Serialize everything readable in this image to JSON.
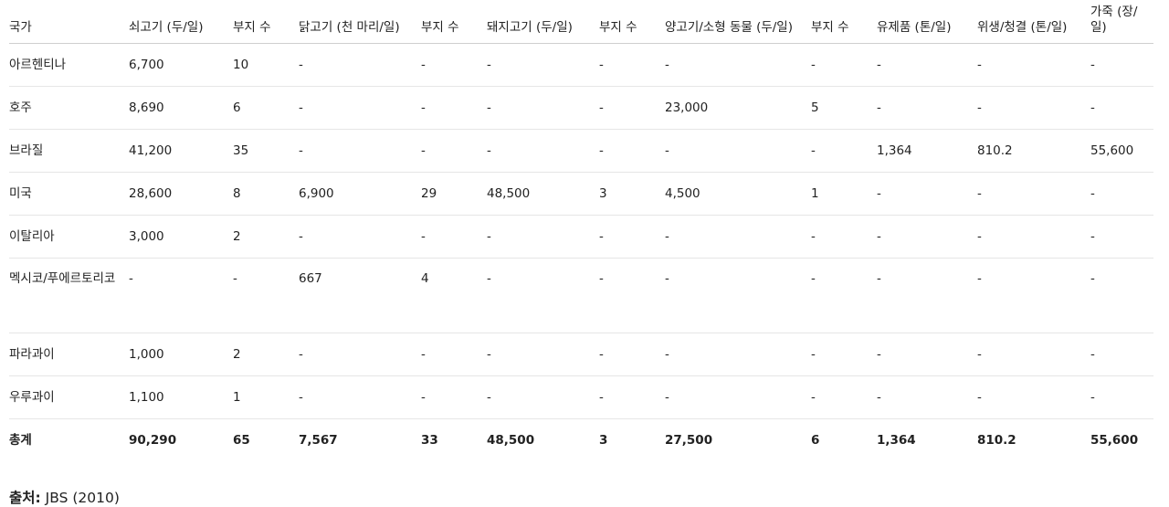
{
  "headers": [
    "국가",
    "쇠고기 (두/일)",
    "부지 수",
    "닭고기 (천 마리/일)",
    "부지 수",
    "돼지고기 (두/일)",
    "부지 수",
    "양고기/소형 동물 (두/일)",
    "부지 수",
    "유제품 (톤/일)",
    "위생/청결 (톤/일)",
    "가죽 (장/일)"
  ],
  "rows": [
    [
      "아르헨티나",
      "6,700",
      "10",
      "-",
      "-",
      "-",
      "-",
      "-",
      "-",
      "-",
      "-",
      "-"
    ],
    [
      "호주",
      "8,690",
      "6",
      "-",
      "-",
      "-",
      "-",
      "23,000",
      "5",
      "-",
      "-",
      "-"
    ],
    [
      "브라질",
      "41,200",
      "35",
      "-",
      "-",
      "-",
      "-",
      "-",
      "-",
      "1,364",
      "810.2",
      "55,600"
    ],
    [
      "미국",
      "28,600",
      "8",
      "6,900",
      "29",
      "48,500",
      "3",
      "4,500",
      "1",
      "-",
      "-",
      "-"
    ],
    [
      "이탈리아",
      "3,000",
      "2",
      "-",
      "-",
      "-",
      "-",
      "-",
      "-",
      "-",
      "-",
      "-"
    ],
    [
      "멕시코/푸에르토리코",
      "-",
      "-",
      "667",
      "4",
      "-",
      "-",
      "-",
      "-",
      "-",
      "-",
      "-"
    ],
    [
      "파라과이",
      "1,000",
      "2",
      "-",
      "-",
      "-",
      "-",
      "-",
      "-",
      "-",
      "-",
      "-"
    ],
    [
      "우루과이",
      "1,100",
      "1",
      "-",
      "-",
      "-",
      "-",
      "-",
      "-",
      "-",
      "-",
      "-"
    ]
  ],
  "total": [
    "총계",
    "90,290",
    "65",
    "7,567",
    "33",
    "48,500",
    "3",
    "27,500",
    "6",
    "1,364",
    "810.2",
    "55,600"
  ],
  "source": {
    "label": "출처:",
    "text": "JBS (2010)"
  }
}
